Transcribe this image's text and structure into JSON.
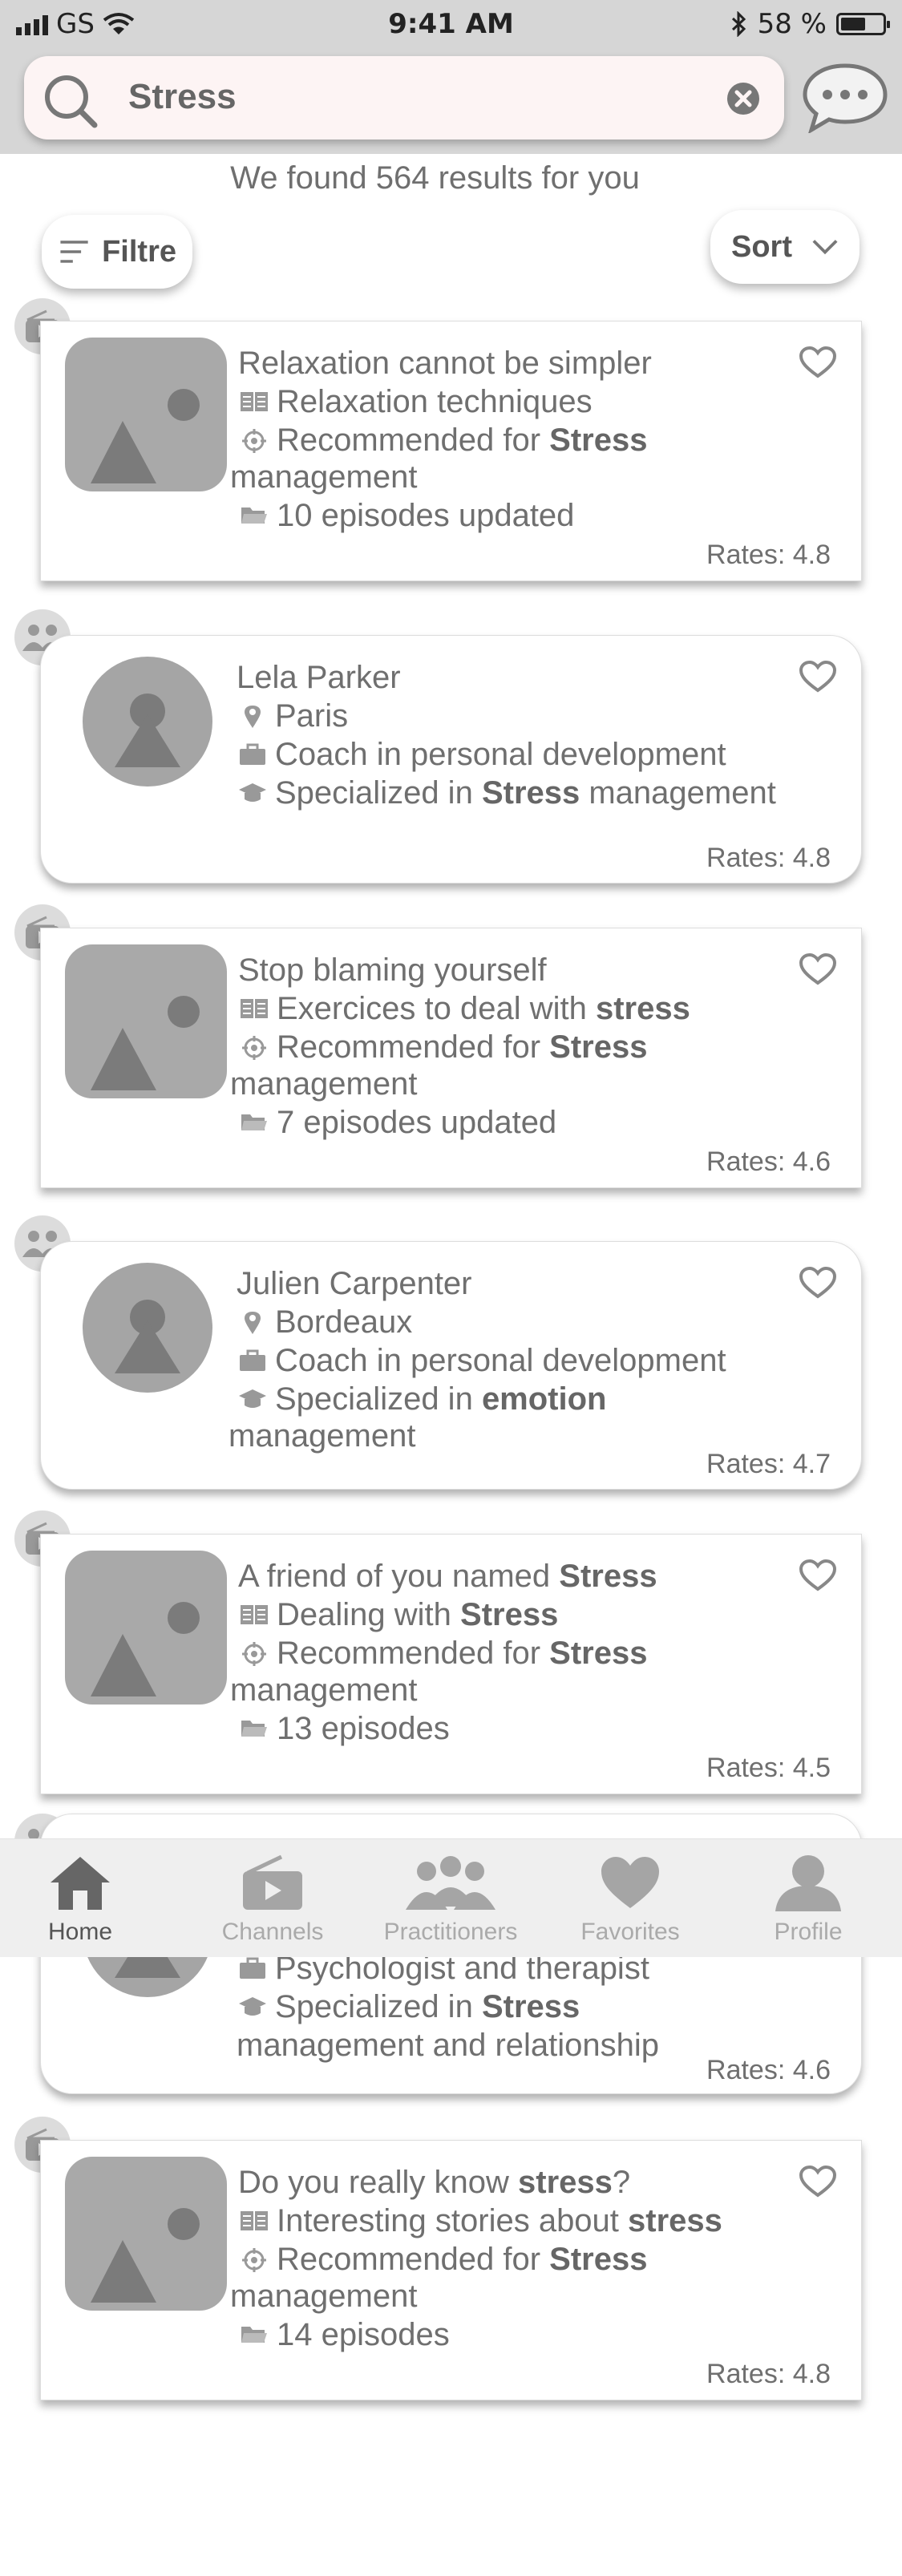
{
  "status_bar": {
    "carrier": "GS",
    "time": "9:41 AM",
    "battery": "58 %"
  },
  "search": {
    "value": "Stress"
  },
  "results_text": "We found 564 results for you",
  "filter_label": "Filtre",
  "sort_label": "Sort",
  "cards": [
    {
      "title": "Relaxation cannot be simpler",
      "category": "Relaxation techniques",
      "recommended_pre": "Recommended for ",
      "recommended_bold": "Stress",
      "recommended_post": " management",
      "episodes": "10 episodes updated",
      "rates": "Rates: 4.8"
    },
    {
      "name": "Lela Parker",
      "location": "Paris",
      "job": "Coach in personal development",
      "spec_pre": "Specialized in ",
      "spec_bold": "Stress",
      "spec_post": " management",
      "rates": "Rates: 4.8"
    },
    {
      "title": "Stop blaming yourself",
      "category_pre": "Exercices to deal with ",
      "category_bold": "stress",
      "recommended_pre": "Recommended for ",
      "recommended_bold": "Stress",
      "recommended_post": " management",
      "episodes": "7 episodes updated",
      "rates": "Rates: 4.6"
    },
    {
      "name": "Julien Carpenter",
      "location": "Bordeaux",
      "job": "Coach in personal development",
      "spec_pre": "Specialized in ",
      "spec_bold": "emotion",
      "spec_post": " management",
      "rates": "Rates: 4.7"
    },
    {
      "title_pre": "A friend of you named ",
      "title_bold": "Stress",
      "category_pre": "Dealing with ",
      "category_bold": "Stress",
      "recommended_pre": "Recommended for ",
      "recommended_bold": "Stress",
      "recommended_post": " management",
      "episodes": "13 episodes",
      "rates": "Rates: 4.5"
    },
    {
      "job": "Psychologist and therapist",
      "spec_pre": "Specialized in ",
      "spec_bold": "Stress",
      "spec_post": " management and relationship",
      "rates": "Rates: 4.6"
    },
    {
      "title_pre": "Do you really know ",
      "title_bold": "stress",
      "title_post": "?",
      "category_pre": "Interesting stories about ",
      "category_bold": "stress",
      "recommended_pre": "Recommended for ",
      "recommended_bold": "Stress",
      "recommended_post": " management",
      "episodes": "14 episodes",
      "rates": "Rates: 4.8"
    }
  ],
  "tabs": [
    {
      "label": "Home",
      "active": true
    },
    {
      "label": "Channels"
    },
    {
      "label": "Practitioners"
    },
    {
      "label": "Favorites"
    },
    {
      "label": "Profile"
    }
  ],
  "colors": {
    "header_bg": "#d6d6d6",
    "placeholder_gray": "#a9a9a9",
    "text_gray": "#6f6f6f",
    "search_bg": "#fdf4f4"
  },
  "icons": [
    "search-icon",
    "clear-icon",
    "chat-icon",
    "filter-icon",
    "chevron-down-icon",
    "play-badge-icon",
    "group-badge-icon",
    "image-placeholder-icon",
    "person-placeholder-icon",
    "book-icon",
    "target-icon",
    "folder-icon",
    "location-pin-icon",
    "briefcase-icon",
    "graduation-cap-icon",
    "heart-icon",
    "home-icon",
    "channels-icon",
    "practitioners-icon",
    "favorites-icon",
    "profile-icon"
  ]
}
